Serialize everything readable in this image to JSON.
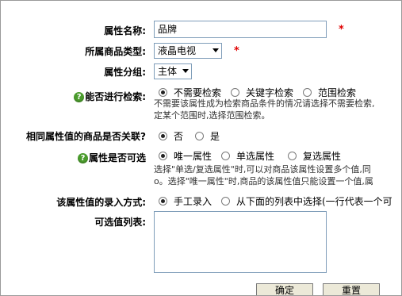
{
  "form": {
    "attr_name": {
      "label": "属性名称:",
      "value": "品牌",
      "required": "*"
    },
    "category": {
      "label": "所属商品类型:",
      "value": "液晶电视",
      "required": "*"
    },
    "group": {
      "label": "属性分组:",
      "value": "主体"
    },
    "searchable": {
      "label": "能否进行检索:",
      "options": [
        "不需要检索",
        "关键字检索",
        "范围检索"
      ],
      "selected": "不需要检索",
      "note_line1": "不需要该属性成为检索商品条件的情况请选择不需要检索,",
      "note_line2": "定某个范围时,选择范围检索。"
    },
    "linked": {
      "label": "相同属性值的商品是否关联?",
      "options": [
        "否",
        "是"
      ],
      "selected": "否"
    },
    "selectable": {
      "label": "属性是否可选",
      "options": [
        "唯一属性",
        "单选属性",
        "复选属性"
      ],
      "selected": "唯一属性",
      "note_line1": "选择\"单选/复选属性\"时,可以对商品该属性设置多个值,同",
      "note_line2": "o。选择\"唯一属性\"时,商品的该属性值只能设置一个值,属"
    },
    "input_type": {
      "label": "该属性值的录入方式:",
      "options": [
        "手工录入",
        "从下面的列表中选择(一行代表一个可"
      ],
      "selected": "手工录入"
    },
    "values_list": {
      "label": "可选值列表:",
      "value": ""
    },
    "buttons": {
      "ok": "确定",
      "reset": "重置"
    }
  },
  "colors": {
    "required": "#e00000",
    "help_icon": "#4a9b2c",
    "input_border": "#7f9db9"
  }
}
